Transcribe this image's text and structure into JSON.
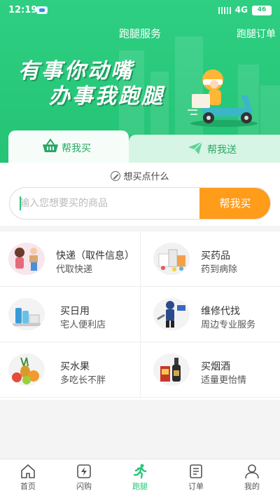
{
  "status_bar": {
    "time": "12:19",
    "network": "4G",
    "battery": "46"
  },
  "header": {
    "title": "跑腿服务",
    "right_link": "跑腿订单"
  },
  "banner": {
    "line1": "有事你动嘴",
    "line2": "办事我跑腿"
  },
  "tabs": [
    {
      "label": "帮我买",
      "icon": "basket-icon",
      "active": true
    },
    {
      "label": "帮我送",
      "icon": "paper-plane-icon",
      "active": false
    }
  ],
  "search": {
    "hint": "想买点什么",
    "placeholder": "输入您想要买的商品",
    "button_label": "帮我买"
  },
  "services": [
    {
      "title": "快递（取件信息）",
      "subtitle": "代取快递",
      "icon": "courier-icon"
    },
    {
      "title": "买药品",
      "subtitle": "药到病除",
      "icon": "medicine-icon"
    },
    {
      "title": "买日用",
      "subtitle": "宅人便利店",
      "icon": "daily-goods-icon"
    },
    {
      "title": "维修代找",
      "subtitle": "周边专业服务",
      "icon": "repairman-icon"
    },
    {
      "title": "买水果",
      "subtitle": "多吃长不胖",
      "icon": "fruit-icon"
    },
    {
      "title": "买烟酒",
      "subtitle": "适量更怡情",
      "icon": "liquor-icon"
    }
  ],
  "bottom_nav": [
    {
      "label": "首页",
      "icon": "home-icon",
      "active": false
    },
    {
      "label": "闪购",
      "icon": "flash-sale-icon",
      "active": false
    },
    {
      "label": "跑腿",
      "icon": "runner-icon",
      "active": true
    },
    {
      "label": "订单",
      "icon": "orders-icon",
      "active": false
    },
    {
      "label": "我的",
      "icon": "profile-icon",
      "active": false
    }
  ],
  "colors": {
    "brand_green": "#27c779",
    "accent_orange": "#ff9c1a"
  }
}
